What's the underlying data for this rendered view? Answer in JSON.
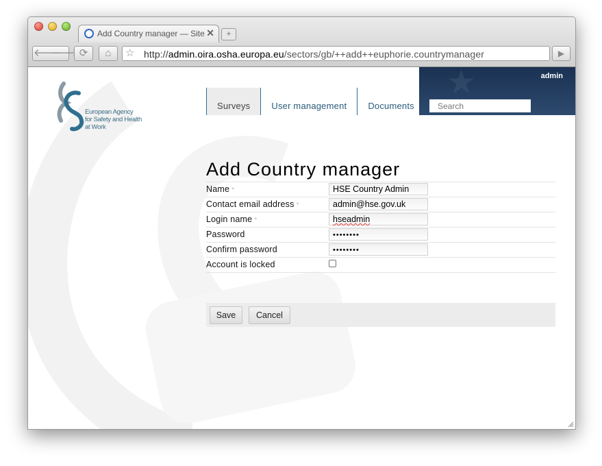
{
  "browser": {
    "tab_title": "Add Country manager — Site",
    "tab_close": "✕",
    "new_tab": "+",
    "url_scheme": "http://",
    "url_host": "admin.oira.osha.europa.eu",
    "url_path": "/sectors/gb/++add++euphorie.countrymanager",
    "back_icon": "🡐",
    "forward_icon": "🡒",
    "reload_icon": "⟳",
    "home_icon": "⌂",
    "star_icon": "☆",
    "go_icon": "▶"
  },
  "site": {
    "logo_text_line1": "European Agency",
    "logo_text_line2": "for Safety and Health",
    "logo_text_line3": "at Work",
    "nav": [
      {
        "label": "Surveys",
        "active": true
      },
      {
        "label": "User management",
        "active": false
      },
      {
        "label": "Documents",
        "active": false
      }
    ],
    "user": "admin",
    "search_placeholder": "Search"
  },
  "form": {
    "title": "Add Country manager",
    "required_mark": "*",
    "fields": [
      {
        "label": "Name",
        "required": true,
        "value": "HSE Country Admin"
      },
      {
        "label": "Contact email address",
        "required": true,
        "value": "admin@hse.gov.uk"
      },
      {
        "label": "Login name",
        "required": true,
        "value": "hseadmin"
      },
      {
        "label": "Password",
        "required": false,
        "value": "••••••••"
      },
      {
        "label": "Confirm password",
        "required": false,
        "value": "••••••••"
      },
      {
        "label": "Account is locked",
        "required": false,
        "checked": false
      }
    ],
    "save_label": "Save",
    "cancel_label": "Cancel"
  },
  "colors": {
    "brand_blue": "#2a5c7c",
    "header_band": "#1f3a5f"
  }
}
